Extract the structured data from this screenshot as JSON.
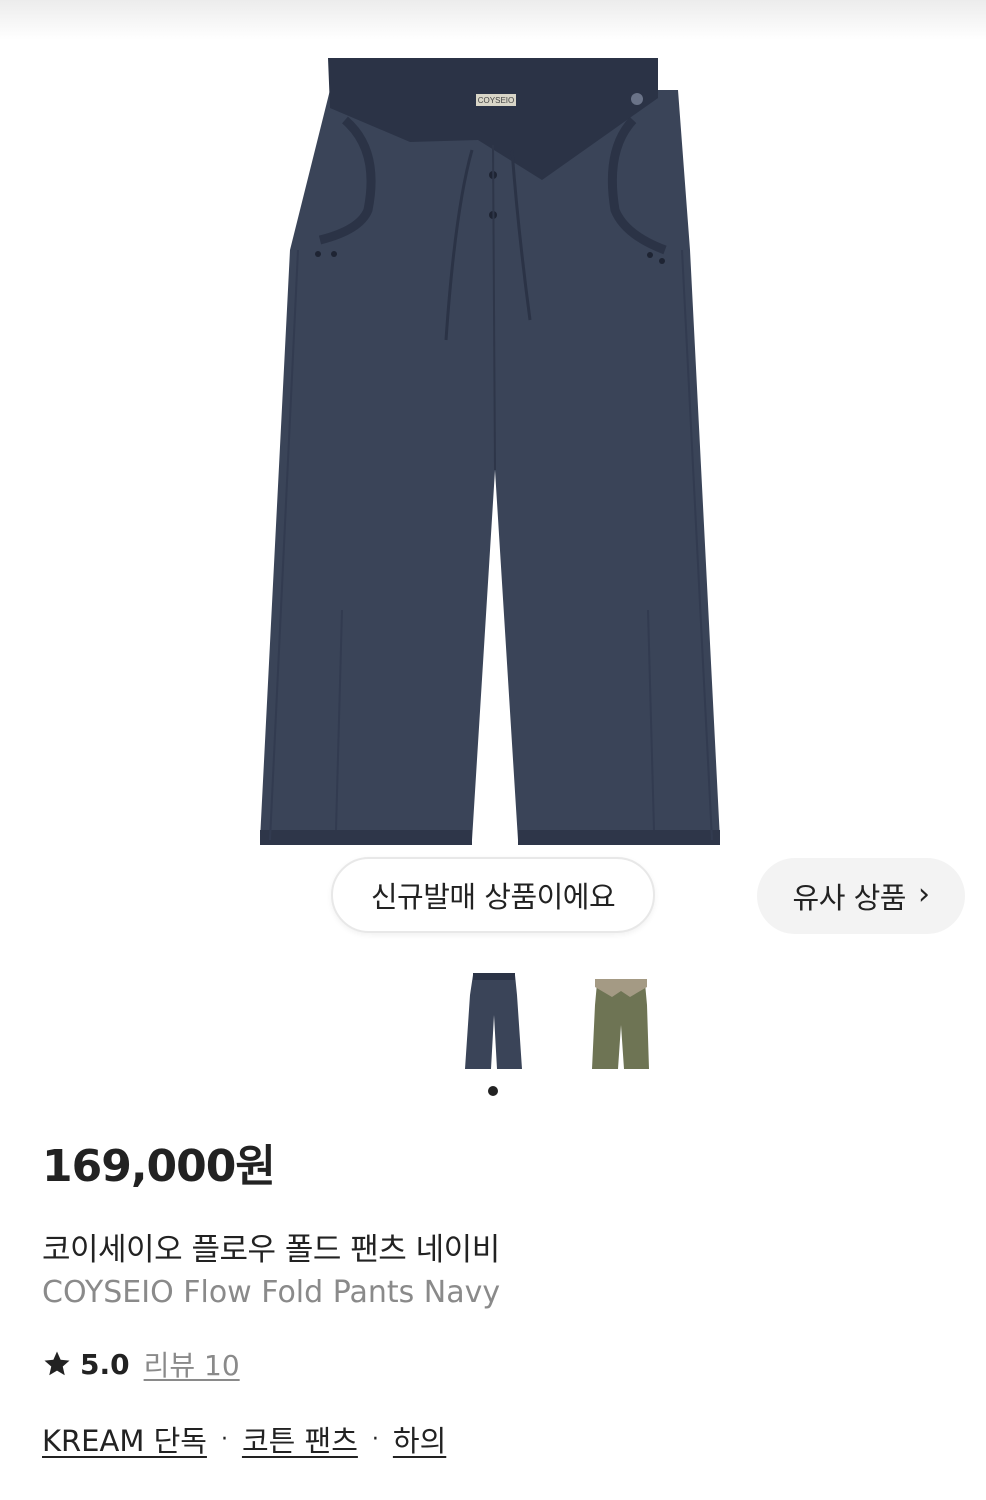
{
  "hero": {
    "new_release_pill": "신규발매 상품이에요",
    "similar_products_pill": "유사 상품",
    "similar_chevron": "›"
  },
  "thumbnails": {
    "count": 2,
    "active_index": 0,
    "colors": [
      "#3a4458",
      "#6e7454"
    ]
  },
  "product": {
    "price": "169,000원",
    "name_ko": "코이세이오 플로우 폴드 팬츠 네이비",
    "name_en": "COYSEIO Flow Fold Pants Navy",
    "brand_label": "COYSEIO",
    "rating": "5.0",
    "review_label": "리뷰 10",
    "tags": [
      "KREAM 단독",
      "코튼 팬츠",
      "하의"
    ],
    "tag_separator": "·"
  },
  "colors": {
    "navy": "#3a4458",
    "navy_dark": "#2b3346",
    "olive": "#6e7454",
    "text": "#222222",
    "muted": "#8a8a8a"
  },
  "icons": {
    "star": "star-icon",
    "chevron": "chevron-right-icon"
  }
}
